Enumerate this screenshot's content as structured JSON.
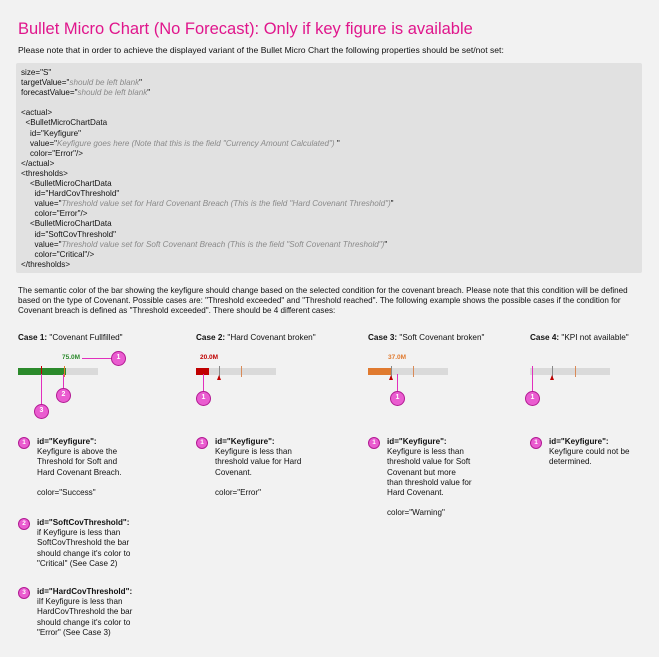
{
  "title": "Bullet Micro Chart (No Forecast): Only if key figure is available",
  "intro": "Please note that in order to achieve the displayed variant of the Bullet Micro Chart the following properties should be set/not set:",
  "code_lines": [
    [
      "size=\"S\"",
      "",
      ""
    ],
    [
      "targetValue=\"",
      "should be left blank",
      "\""
    ],
    [
      "forecastValue=\"",
      "should be left blank",
      "\""
    ],
    [
      "",
      "",
      ""
    ],
    [
      "<actual>",
      "",
      ""
    ],
    [
      "  <BulletMicroChartData",
      "",
      ""
    ],
    [
      "    id=\"Keyfigure\"",
      "",
      ""
    ],
    [
      "    value=\"",
      "Keyfigure goes here (Note that this is the field \"Currency Amount Calculated\")",
      " \""
    ],
    [
      "    color=\"Error\"/>",
      "",
      ""
    ],
    [
      "</actual>",
      "",
      ""
    ],
    [
      "<thresholds>",
      "",
      ""
    ],
    [
      "    <BulletMicroChartData",
      "",
      ""
    ],
    [
      "      id=\"HardCovThreshold\"",
      "",
      ""
    ],
    [
      "      value=\"",
      "Threshold value set for Hard Covenant Breach (This is the field \"Hard Covenant Threshold\")",
      "\""
    ],
    [
      "      color=\"Error\"/>",
      "",
      ""
    ],
    [
      "    <BulletMicroChartData",
      "",
      ""
    ],
    [
      "      id=\"SoftCovThreshold\"",
      "",
      ""
    ],
    [
      "      value=\"",
      "Threshold value set for Soft Covenant Breach (This is the field \"Soft Covenant Threshold\")",
      "\""
    ],
    [
      "      color=\"Critical\"/>",
      "",
      ""
    ],
    [
      "</thresholds>",
      "",
      ""
    ]
  ],
  "paragraph": "The semantic color of the bar showing the keyfigure should change based on the selected condition for the covenant breach. Please note that this condition will be defined based on the type of Covenant. Possible cases are: \"Threshold exceeded\"  and \"Threshold reached\". The following example shows the possible cases if the condition for Covenant breach is defined as \"Threshold exceeded\". There should be 4 different cases:",
  "cases": [
    {
      "label": "Case 1:",
      "title": " \"Covenant Fullfilled\"",
      "value": "75.0M",
      "value_color": "#2b8a2b",
      "fill_color": "#2b8a2b",
      "value_fraction": 0.6
    },
    {
      "label": "Case 2:",
      "title": " \"Hard Covenant broken\"",
      "value": "20.0M",
      "value_color": "#c00000",
      "fill_color": "#c00000",
      "value_fraction": 0.16
    },
    {
      "label": "Case 3:",
      "title": " \"Soft Covenant broken\"",
      "value": "37.0M",
      "value_color": "#e07a2f",
      "fill_color": "#e07a2f",
      "value_fraction": 0.29
    },
    {
      "label": "Case 4:",
      "title": " \"KPI not available\"",
      "value": "",
      "value_color": "#888888",
      "fill_color": "#dadada",
      "value_fraction": 0
    }
  ],
  "badges": {
    "one": "1",
    "two": "2",
    "three": "3"
  },
  "notes": {
    "c1_1_id": "id=\"Keyfigure\":",
    "c1_1_text": [
      "Keyfigure is above the",
      "Threshold for Soft and",
      "Hard Covenant Breach."
    ],
    "c1_1_color": "color=\"Success\"",
    "c1_2_id": "id=\"SoftCovThreshold\":",
    "c1_2_text": [
      "if Keyfigure is less than",
      "SoftCovThreshold the bar",
      "should change it's color to",
      "\"Critical\" (See Case 2)"
    ],
    "c1_3_id": "id=\"HardCovThreshold\":",
    "c1_3_text": [
      "iIf Keyfigure is less than",
      "HardCovThreshold the bar",
      "should change it's color to",
      "\"Error\" (See Case 3)"
    ],
    "c2_id": "id=\"Keyfigure\":",
    "c2_text": [
      "Keyfigure is less than",
      "threshold value for Hard",
      "Covenant."
    ],
    "c2_color": "color=\"Error\"",
    "c3_id": "id=\"Keyfigure\":",
    "c3_text": [
      "Keyfigure is less than",
      "threshold value for Soft",
      "Covenant  but more",
      "than threshold value for",
      "Hard Covenant."
    ],
    "c3_color": "color=\"Warning\"",
    "c4_id": "id=\"Keyfigure\":",
    "c4_text": [
      "Keyfigure could not be",
      "determined."
    ]
  }
}
